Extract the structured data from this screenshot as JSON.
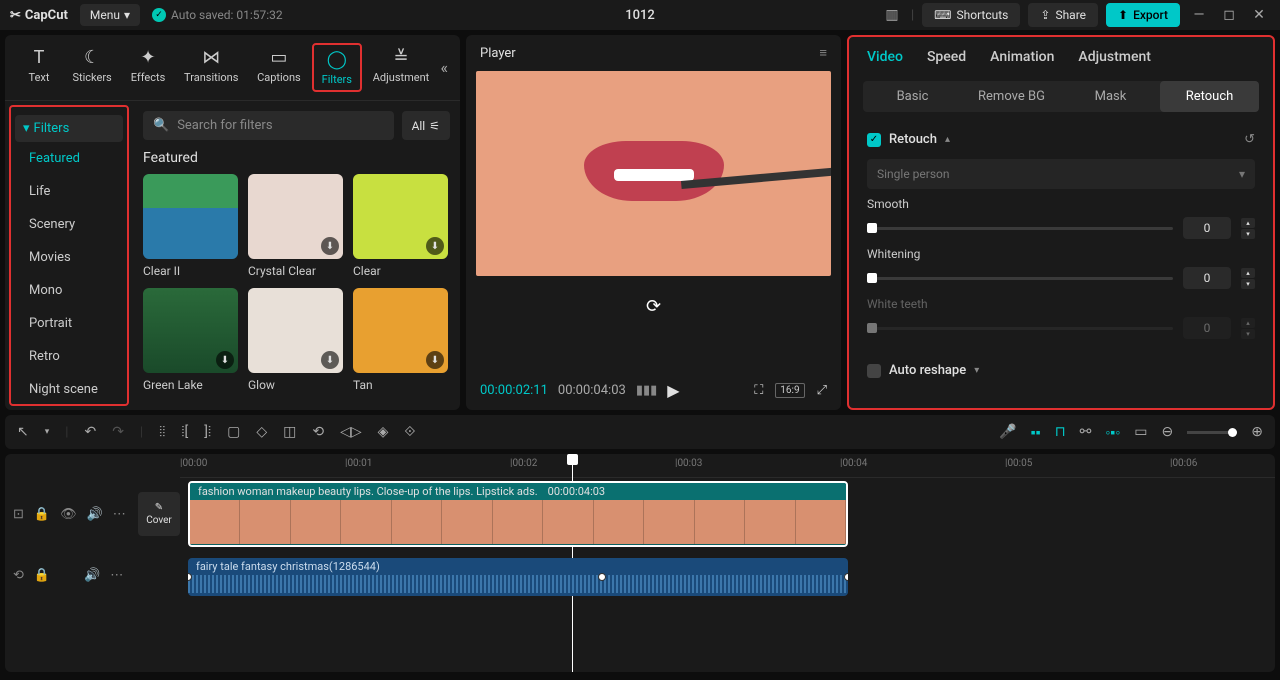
{
  "titlebar": {
    "brand": "CapCut",
    "menu": "Menu",
    "autosave": "Auto saved: 01:57:32",
    "project_title": "1012",
    "shortcuts": "Shortcuts",
    "share": "Share",
    "export": "Export"
  },
  "tools": [
    {
      "label": "Text"
    },
    {
      "label": "Stickers"
    },
    {
      "label": "Effects"
    },
    {
      "label": "Transitions"
    },
    {
      "label": "Captions"
    },
    {
      "label": "Filters"
    },
    {
      "label": "Adjustment"
    }
  ],
  "sidebar": {
    "header": "Filters",
    "items": [
      "Featured",
      "Life",
      "Scenery",
      "Movies",
      "Mono",
      "Portrait",
      "Retro",
      "Night scene"
    ]
  },
  "search": {
    "placeholder": "Search for filters",
    "all": "All"
  },
  "category_title": "Featured",
  "filters": [
    {
      "name": "Clear II",
      "bg": "linear-gradient(#3a9a5a 40%,#2a7aaa 40%)"
    },
    {
      "name": "Crystal Clear",
      "bg": "#e8d8d0"
    },
    {
      "name": "Clear",
      "bg": "#c8e040"
    },
    {
      "name": "Green Lake",
      "bg": "linear-gradient(#2a6a3a,#1a4a2a)"
    },
    {
      "name": "Glow",
      "bg": "#e8e0d8"
    },
    {
      "name": "Tan",
      "bg": "#e8a030"
    }
  ],
  "player": {
    "title": "Player",
    "current": "00:00:02:11",
    "duration": "00:00:04:03",
    "ratio": "16:9"
  },
  "right": {
    "tabs": [
      "Video",
      "Speed",
      "Animation",
      "Adjustment"
    ],
    "subtabs": [
      "Basic",
      "Remove BG",
      "Mask",
      "Retouch"
    ],
    "retouch_label": "Retouch",
    "person_select": "Single person",
    "smooth": {
      "label": "Smooth",
      "value": "0"
    },
    "whitening": {
      "label": "Whitening",
      "value": "0"
    },
    "white_teeth": {
      "label": "White teeth",
      "value": "0"
    },
    "auto_reshape": "Auto reshape"
  },
  "ruler": [
    "00:00",
    "00:01",
    "00:02",
    "00:03",
    "00:04",
    "00:05",
    "00:06"
  ],
  "tracks": {
    "cover": "Cover",
    "video_clip": {
      "title": "fashion woman makeup beauty lips. Close-up of the lips. Lipstick ads.",
      "dur": "00:00:04:03"
    },
    "audio_clip": {
      "title": "fairy tale fantasy christmas(1286544)"
    }
  }
}
